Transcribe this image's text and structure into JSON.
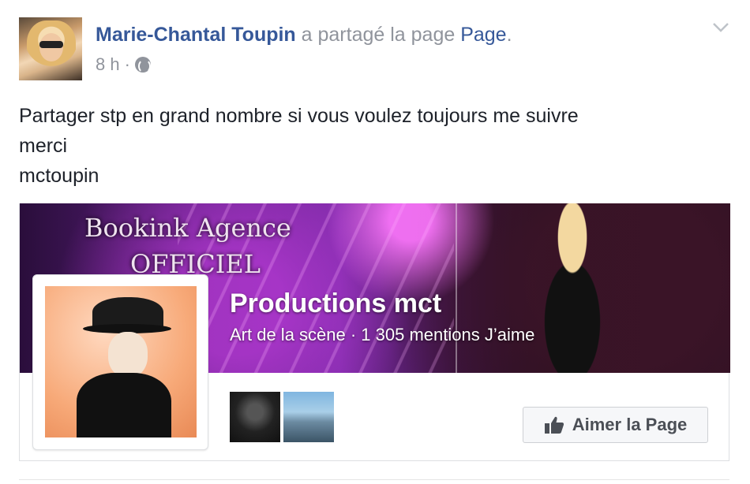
{
  "post": {
    "author_name": "Marie-Chantal Toupin",
    "shared_text": " a partagé la page ",
    "page_link": "Page",
    "period": ".",
    "time": "8 h",
    "dot": "·",
    "audience_icon": "globe-icon",
    "options_icon": "chevron-down-icon",
    "text_lines": [
      "Partager stp en grand nombre si vous voulez toujours me suivre",
      "merci",
      "mctoupin"
    ]
  },
  "page_card": {
    "cover_text_line1": "Bookink Agence",
    "cover_text_line2": "OFFICIEL",
    "title": "Productions mct",
    "subtitle": "Art de la scène · 1 305 mentions J’aime",
    "like_button_label": "Aimer la Page",
    "like_icon": "thumbs-up-icon"
  },
  "colors": {
    "link_blue": "#365899",
    "meta_gray": "#90949c",
    "text": "#1d2129",
    "button_bg": "#f6f7f9",
    "button_text": "#4b4f56"
  }
}
